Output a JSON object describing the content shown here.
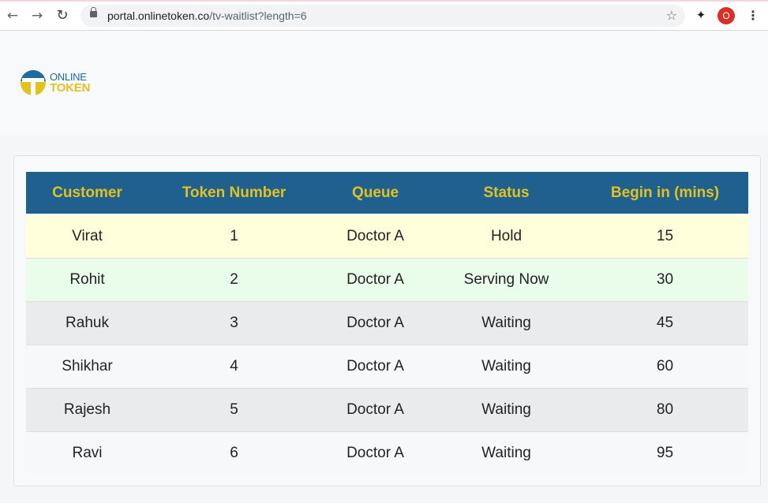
{
  "browser": {
    "url_host": "portal.onlinetoken.co",
    "url_path": "/tv-waitlist?length=6",
    "profile_initial": "O",
    "icons": {
      "back": "arrow-left-icon",
      "forward": "arrow-right-icon",
      "reload": "reload-icon",
      "lock": "lock-icon",
      "bookmark": "star-icon",
      "extensions": "puzzle-icon",
      "menu": "kebab-menu-icon"
    }
  },
  "brand": {
    "line1": "ONLINE",
    "line2": "TOKEN",
    "colors": {
      "blue": "#1f6aa1",
      "yellow": "#e2c221"
    }
  },
  "table": {
    "headers": [
      "Customer",
      "Token Number",
      "Queue",
      "Status",
      "Begin in (mins)"
    ],
    "header_bg": "#20608f",
    "header_fg": "#e2c221",
    "rows": [
      {
        "customer": "Virat",
        "token": "1",
        "queue": "Doctor A",
        "status": "Hold",
        "begin": "15"
      },
      {
        "customer": "Rohit",
        "token": "2",
        "queue": "Doctor A",
        "status": "Serving Now",
        "begin": "30"
      },
      {
        "customer": "Rahuk",
        "token": "3",
        "queue": "Doctor A",
        "status": "Waiting",
        "begin": "45"
      },
      {
        "customer": "Shikhar",
        "token": "4",
        "queue": "Doctor A",
        "status": "Waiting",
        "begin": "60"
      },
      {
        "customer": "Rajesh",
        "token": "5",
        "queue": "Doctor A",
        "status": "Waiting",
        "begin": "80"
      },
      {
        "customer": "Ravi",
        "token": "6",
        "queue": "Doctor A",
        "status": "Waiting",
        "begin": "95"
      }
    ]
  }
}
